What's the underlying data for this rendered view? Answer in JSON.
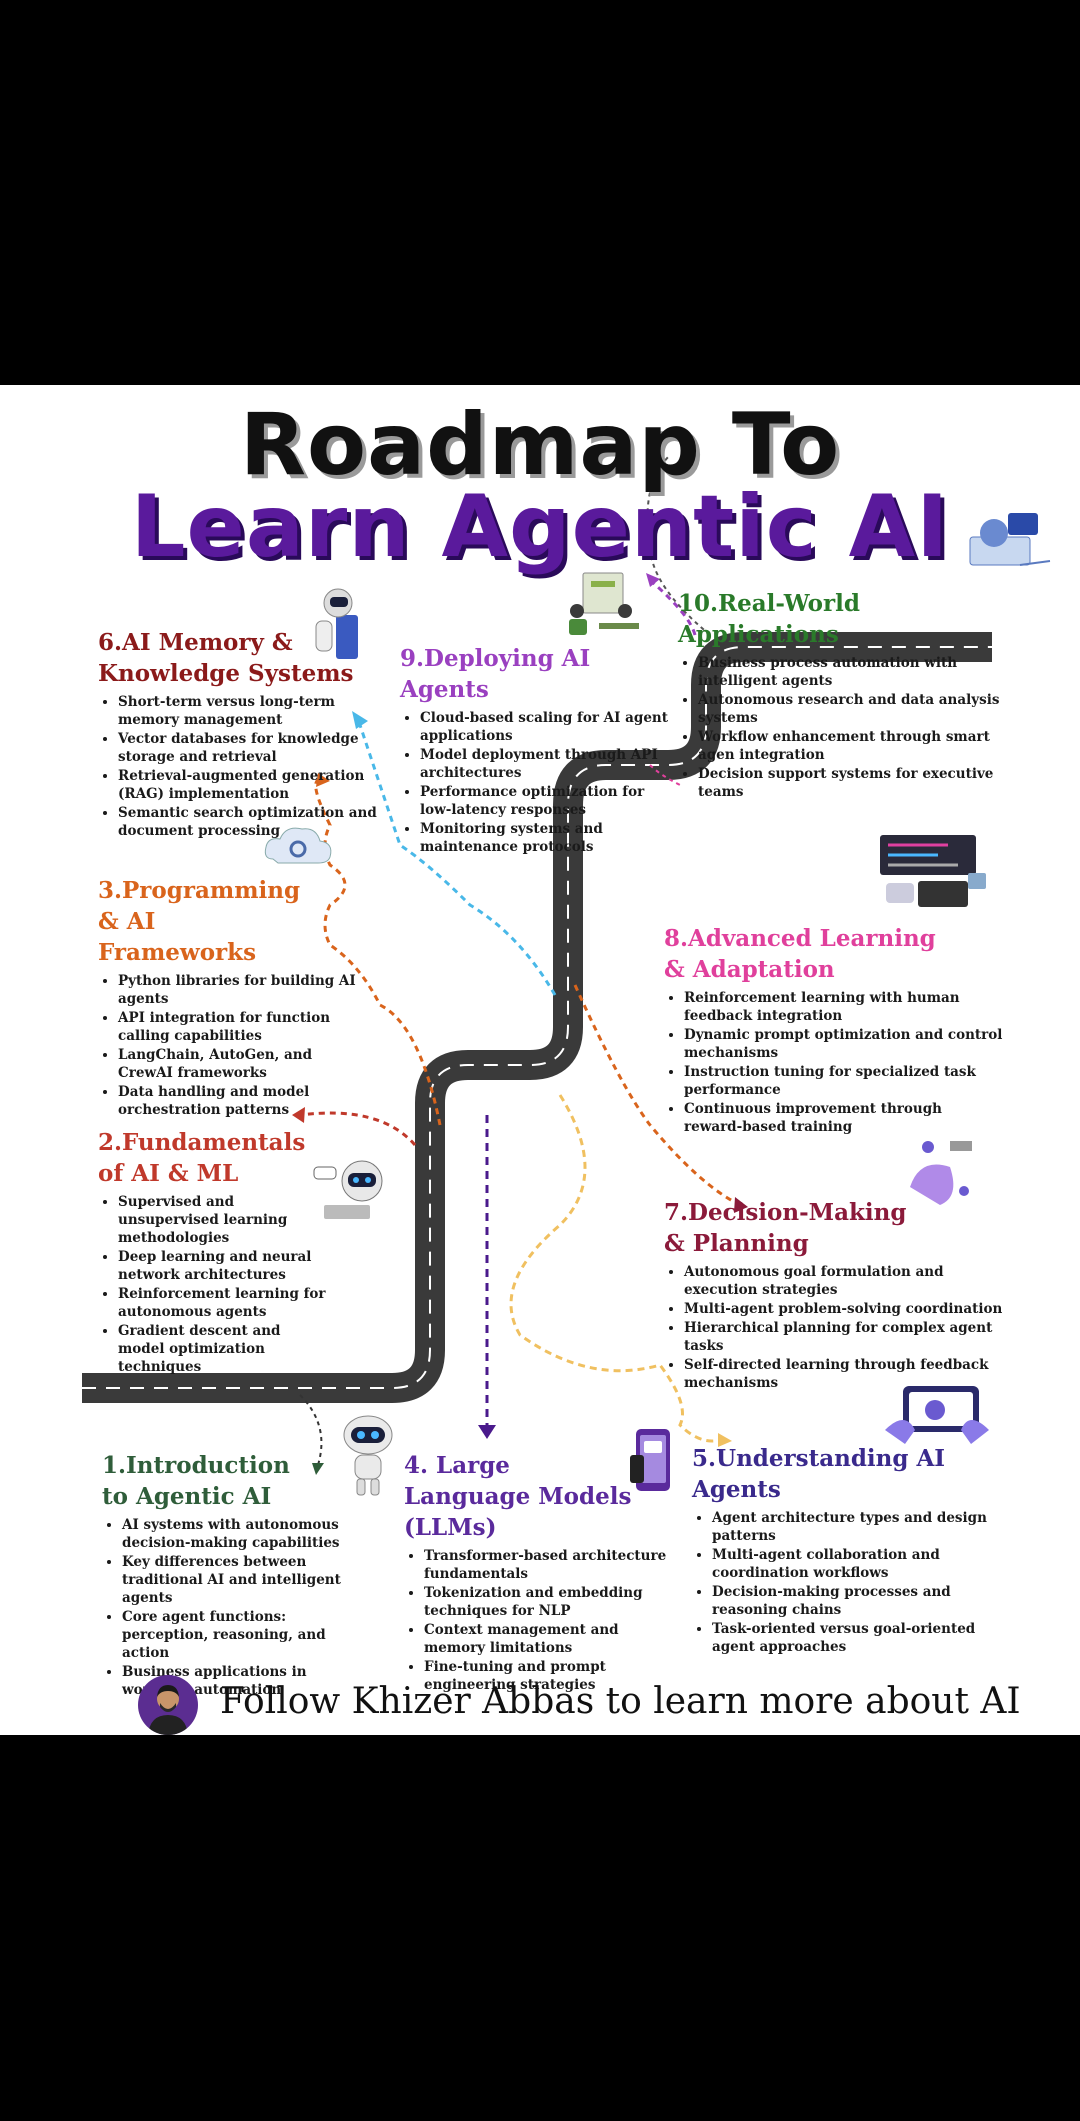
{
  "title": {
    "line1": "Roadmap To",
    "line2": "Learn Agentic AI"
  },
  "sections": [
    {
      "id": "s1",
      "title": "1.Introduction to Agentic AI",
      "color": "#2f5d3a",
      "items": [
        "AI systems with autonomous decision-making capabilities",
        "Key differences between traditional AI and intelligent agents",
        "Core agent functions: perception, reasoning, and action",
        "Business applications in workflow automation"
      ]
    },
    {
      "id": "s2",
      "title": "2.Fundamentals of AI & ML",
      "color": "#c0392b",
      "items": [
        "Supervised and unsupervised learning methodologies",
        "Deep learning and neural network architectures",
        "Reinforcement learning for autonomous agents",
        "Gradient descent and model optimization techniques"
      ]
    },
    {
      "id": "s3",
      "title": "3.Programming & AI Frameworks",
      "color": "#d9641c",
      "items": [
        "Python libraries for building AI agents",
        "API integration for function calling capabilities",
        "LangChain, AutoGen, and CrewAI frameworks",
        "Data handling and model orchestration patterns"
      ]
    },
    {
      "id": "s4",
      "title": "4. Large Language Models (LLMs)",
      "color": "#5a2a9c",
      "items": [
        "Transformer-based architecture fundamentals",
        "Tokenization and embedding techniques for NLP",
        "Context management and memory limitations",
        "Fine-tuning and prompt engineering strategies"
      ]
    },
    {
      "id": "s5",
      "title": "5.Understanding AI Agents",
      "color": "#3a2a8c",
      "items": [
        "Agent architecture types and design patterns",
        "Multi-agent collaboration and coordination workflows",
        "Decision-making processes and reasoning chains",
        "Task-oriented versus goal-oriented agent approaches"
      ]
    },
    {
      "id": "s6",
      "title": "6.AI Memory & Knowledge Systems",
      "color": "#8b1a1a",
      "items": [
        "Short-term versus long-term memory management",
        "Vector databases for knowledge storage and retrieval",
        "Retrieval-augmented generation (RAG) implementation",
        "Semantic search optimization and document processing"
      ]
    },
    {
      "id": "s7",
      "title": "7.Decision-Making & Planning",
      "color": "#8b1a3a",
      "items": [
        "Autonomous goal formulation and execution strategies",
        "Multi-agent problem-solving coordination",
        "Hierarchical planning for complex agent tasks",
        "Self-directed learning through feedback mechanisms"
      ]
    },
    {
      "id": "s8",
      "title": "8.Advanced Learning & Adaptation",
      "color": "#e0409c",
      "items": [
        "Reinforcement learning with human feedback integration",
        "Dynamic prompt optimization and control mechanisms",
        "Instruction tuning for specialized task performance",
        "Continuous improvement through reward-based training"
      ]
    },
    {
      "id": "s9",
      "title": "9.Deploying AI Agents",
      "color": "#9a40c0",
      "items": [
        "Cloud-based scaling for AI agent applications",
        "Model deployment through API architectures",
        "Performance optimization for low-latency responses",
        "Monitoring systems and maintenance protocols"
      ]
    },
    {
      "id": "s10",
      "title": "10.Real-World Applications",
      "color": "#2a7a2a",
      "items": [
        "Business process automation with intelligent agents",
        "Autonomous research and data analysis systems",
        "Workflow enhancement through smart agen integration",
        "Decision support systems for executive teams"
      ]
    }
  ],
  "icons": [
    "robot-icon",
    "chatbot-laptop-icon",
    "cloud-gear-icon",
    "robot-server-icon",
    "mobile-ai-icon",
    "tablet-robot-icon",
    "brain-laptop-icon",
    "network-hand-icon",
    "dashboard-icon",
    "team-desk-icon",
    "ai-brain-icon"
  ],
  "footer": {
    "text": "Follow Khizer Abbas to learn more about AI"
  },
  "colors": {
    "road": "#3a3a3a",
    "road_line": "#ffffff",
    "title_accent": "#5a1a9c",
    "background": "#000000",
    "card": "#ffffff"
  }
}
